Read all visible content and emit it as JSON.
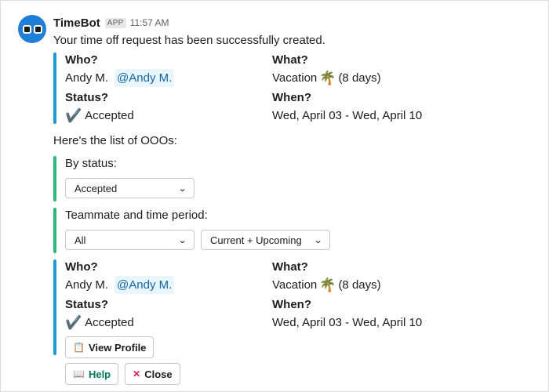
{
  "message": {
    "bot_name": "TimeBot",
    "app_badge": "APP",
    "timestamp": "11:57 AM",
    "intro": "Your time off request has been successfully created."
  },
  "request_card": {
    "who_label": "Who?",
    "who_value": "Andy M.",
    "who_mention": "@Andy M.",
    "what_label": "What?",
    "what_value": "Vacation",
    "what_emoji": "🌴",
    "what_duration": "(8 days)",
    "status_label": "Status?",
    "status_icon": "✔️",
    "status_value": "Accepted",
    "when_label": "When?",
    "when_value": "Wed, April 03 - Wed, April 10"
  },
  "list_heading": "Here's the list of OOOs:",
  "by_status": {
    "label": "By status:",
    "selected": "Accepted"
  },
  "teammate_filter": {
    "label": "Teammate and time period:",
    "teammate_selected": "All",
    "period_selected": "Current + Upcoming"
  },
  "ooo_card": {
    "who_label": "Who?",
    "who_value": "Andy M.",
    "who_mention": "@Andy M.",
    "what_label": "What?",
    "what_value": "Vacation",
    "what_emoji": "🌴",
    "what_duration": "(8 days)",
    "status_label": "Status?",
    "status_icon": "✔️",
    "status_value": "Accepted",
    "when_label": "When?",
    "when_value": "Wed, April 03 - Wed, April 10",
    "view_profile_icon": "📋",
    "view_profile_label": "View Profile"
  },
  "actions": {
    "help_icon": "📖",
    "help_label": "Help",
    "close_icon": "✕",
    "close_label": "Close"
  },
  "icons": {
    "avatar": "robot-avatar-icon",
    "dropdown": "chevron-down-icon"
  },
  "colors": {
    "avatar": "#1f7fd6",
    "bar_blue": "#1d9bd1",
    "bar_green": "#2eb67d",
    "mention": "#1264a3",
    "help_text": "#007a5a",
    "close_icon": "#e01e5a"
  }
}
